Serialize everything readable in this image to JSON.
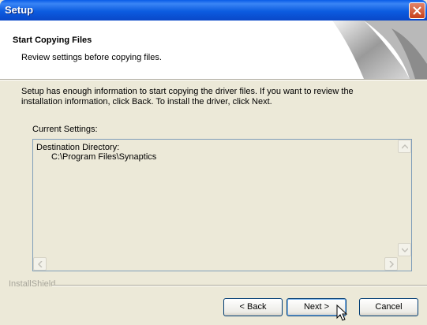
{
  "window": {
    "title": "Setup"
  },
  "header": {
    "title": "Start Copying Files",
    "subtitle": "Review settings before copying files."
  },
  "body": {
    "description_line1": "Setup has enough information to start copying the driver files. If you want to review the",
    "description_line2": "installation information, click Back. To install the driver, click Next.",
    "settings_label": "Current Settings:",
    "settings_line1": "Destination Directory:",
    "settings_line2": "C:\\Program Files\\Synaptics"
  },
  "footer": {
    "brand": "InstallShield",
    "back_label": "< Back",
    "next_label": "Next >",
    "cancel_label": "Cancel"
  },
  "icons": [
    "close-icon",
    "header-graphic-icon",
    "scroll-up-arrow-icon",
    "scroll-down-arrow-icon",
    "scroll-left-arrow-icon",
    "scroll-right-arrow-icon",
    "mouse-cursor-icon"
  ]
}
